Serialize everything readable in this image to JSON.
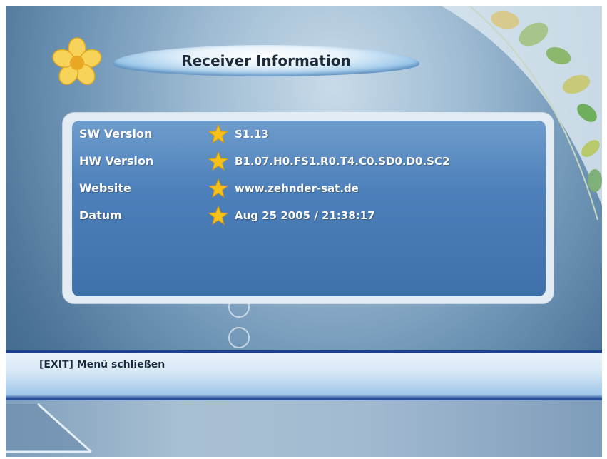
{
  "header": {
    "title": "Receiver Information"
  },
  "info": {
    "rows": [
      {
        "label": "SW Version",
        "value": "S1.13"
      },
      {
        "label": "HW Version",
        "value": "B1.07.H0.FS1.R0.T4.C0.SD0.D0.SC2"
      },
      {
        "label": "Website",
        "value": "www.zehnder-sat.de"
      },
      {
        "label": "Datum",
        "value": "Aug 25 2005 / 21:38:17"
      }
    ]
  },
  "footer": {
    "hint": "[EXIT] Menü schließen"
  },
  "colors": {
    "panel": "#4d80ba",
    "star": "#f6c21a",
    "text": "#ffffff"
  },
  "icons": {
    "logo": "flower-icon",
    "bullet": "star-icon"
  }
}
